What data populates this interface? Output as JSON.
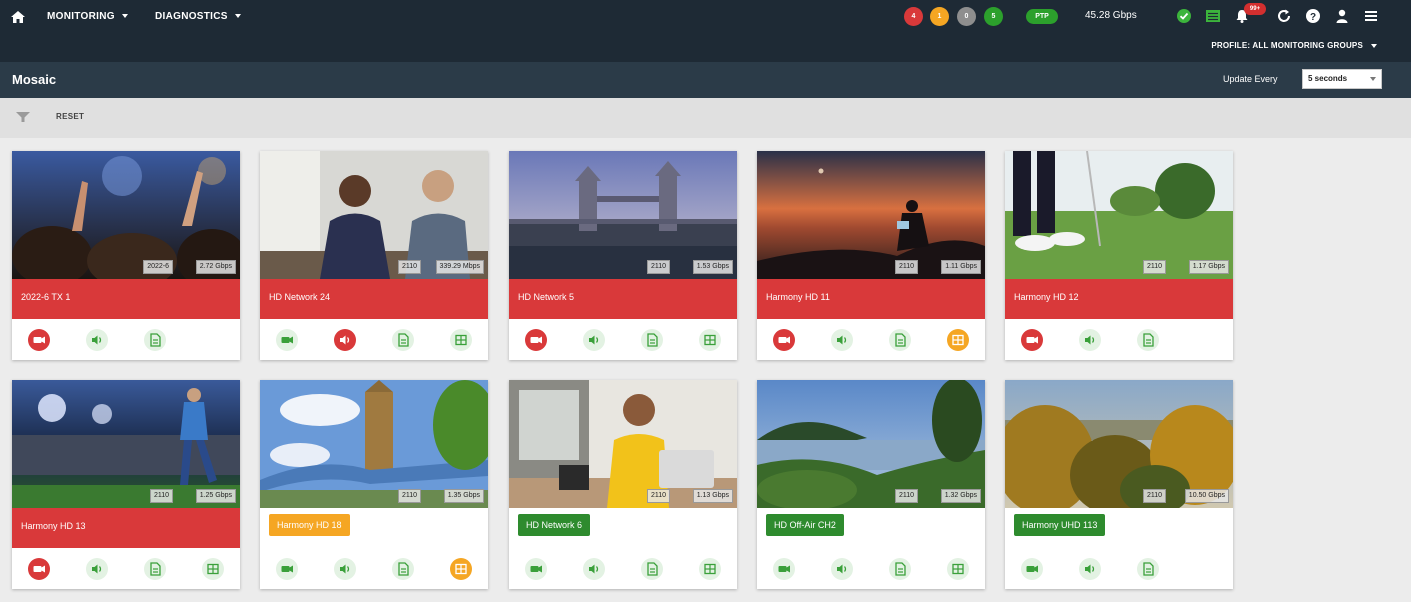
{
  "topnav": {
    "menus": [
      {
        "label": "MONITORING"
      },
      {
        "label": "DIAGNOSTICS"
      }
    ],
    "alarm_counts": [
      {
        "value": "4",
        "color": "#d9393a"
      },
      {
        "value": "1",
        "color": "#f5a623"
      },
      {
        "value": "0",
        "color": "#8e8e8e"
      },
      {
        "value": "5",
        "color": "#2ca02c"
      }
    ],
    "ptp_label": "PTP",
    "bandwidth": "45.28 Gbps",
    "notification_count": "99+",
    "profile_label": "PROFILE: ALL MONITORING GROUPS",
    "icons": [
      "home-icon",
      "check-circle-icon",
      "list-icon",
      "bell-icon",
      "refresh-icon",
      "help-icon",
      "user-icon",
      "menu-icon"
    ]
  },
  "titlebar": {
    "title": "Mosaic",
    "update_label": "Update Every",
    "update_value": "5 seconds"
  },
  "filterbar": {
    "reset_label": "RESET"
  },
  "cards": [
    {
      "name": "2022-6 TX 1",
      "status": "red",
      "id": "2022-6",
      "rate": "2.72 Gbps",
      "icons": [
        "video-alarm",
        "audio-ok",
        "doc-ok"
      ]
    },
    {
      "name": "HD Network 24",
      "status": "red",
      "id": "2110",
      "rate": "339.29 Mbps",
      "icons": [
        "video-ok",
        "audio-alarm",
        "doc-ok",
        "data-ok"
      ]
    },
    {
      "name": "HD Network 5",
      "status": "red",
      "id": "2110",
      "rate": "1.53 Gbps",
      "icons": [
        "video-alarm",
        "audio-ok",
        "doc-ok",
        "data-ok"
      ]
    },
    {
      "name": "Harmony HD 11",
      "status": "red",
      "id": "2110",
      "rate": "1.11 Gbps",
      "icons": [
        "video-alarm",
        "audio-ok",
        "doc-ok",
        "data-warning"
      ]
    },
    {
      "name": "Harmony HD 12",
      "status": "red",
      "id": "2110",
      "rate": "1.17 Gbps",
      "icons": [
        "video-alarm",
        "audio-ok",
        "doc-ok"
      ]
    },
    {
      "name": "Harmony HD 13",
      "status": "red",
      "id": "2110",
      "rate": "1.25 Gbps",
      "icons": [
        "video-alarm",
        "audio-ok",
        "doc-ok",
        "data-ok"
      ]
    },
    {
      "name": "Harmony HD 18",
      "status": "orange",
      "id": "2110",
      "rate": "1.35 Gbps",
      "icons": [
        "video-ok",
        "audio-ok",
        "doc-ok",
        "data-warning"
      ]
    },
    {
      "name": "HD Network 6",
      "status": "green",
      "id": "2110",
      "rate": "1.13 Gbps",
      "icons": [
        "video-ok",
        "audio-ok",
        "doc-ok",
        "data-ok"
      ]
    },
    {
      "name": "HD Off-Air CH2",
      "status": "green",
      "id": "2110",
      "rate": "1.32 Gbps",
      "icons": [
        "video-ok",
        "audio-ok",
        "doc-ok",
        "data-ok"
      ]
    },
    {
      "name": "Harmony UHD 113",
      "status": "green",
      "id": "2110",
      "rate": "10.50 Gbps",
      "icons": [
        "video-ok",
        "audio-ok",
        "doc-ok"
      ]
    }
  ],
  "colors": {
    "alarm": "#d9393a",
    "warning": "#f5a623",
    "ok": "#2e8b2e",
    "nav": "#1e2a35",
    "titlebar": "#2b3b48"
  }
}
